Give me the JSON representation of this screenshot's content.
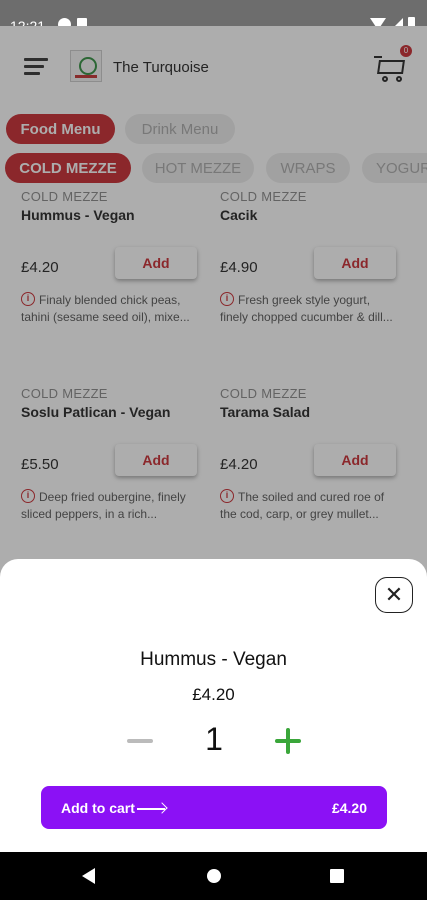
{
  "status": {
    "time": "12:21"
  },
  "header": {
    "brand": "The Turquoise",
    "cart_count": "0"
  },
  "menu_tabs": [
    {
      "label": "Food Menu",
      "active": true
    },
    {
      "label": "Drink Menu",
      "active": false
    }
  ],
  "categories": [
    {
      "label": "COLD MEZZE",
      "active": true
    },
    {
      "label": "HOT MEZZE",
      "active": false
    },
    {
      "label": "WRAPS",
      "active": false
    },
    {
      "label": "YOGUR",
      "active": false
    }
  ],
  "items": [
    {
      "category": "COLD MEZZE",
      "name": "Hummus - Vegan",
      "price": "£4.20",
      "add_label": "Add",
      "desc": "Finaly blended chick peas, tahini (sesame seed oil), mixe..."
    },
    {
      "category": "COLD MEZZE",
      "name": "Cacik",
      "price": "£4.90",
      "add_label": "Add",
      "desc": "Fresh greek style yogurt, finely chopped cucumber & dill..."
    },
    {
      "category": "COLD MEZZE",
      "name": "Soslu Patlican - Vegan",
      "price": "£5.50",
      "add_label": "Add",
      "desc": "Deep fried oubergine, finely sliced peppers, in a rich..."
    },
    {
      "category": "COLD MEZZE",
      "name": "Tarama Salad",
      "price": "£4.20",
      "add_label": "Add",
      "desc": "The soiled and cured roe of the cod, carp, or grey mullet..."
    }
  ],
  "sheet": {
    "title": "Hummus - Vegan",
    "price": "£4.20",
    "quantity": "1",
    "add_to_cart_label": "Add to cart",
    "total": "£4.20"
  },
  "colors": {
    "brand_red": "#c8282e",
    "cta_purple": "#8b11f5",
    "plus_green": "#3aa63a"
  }
}
